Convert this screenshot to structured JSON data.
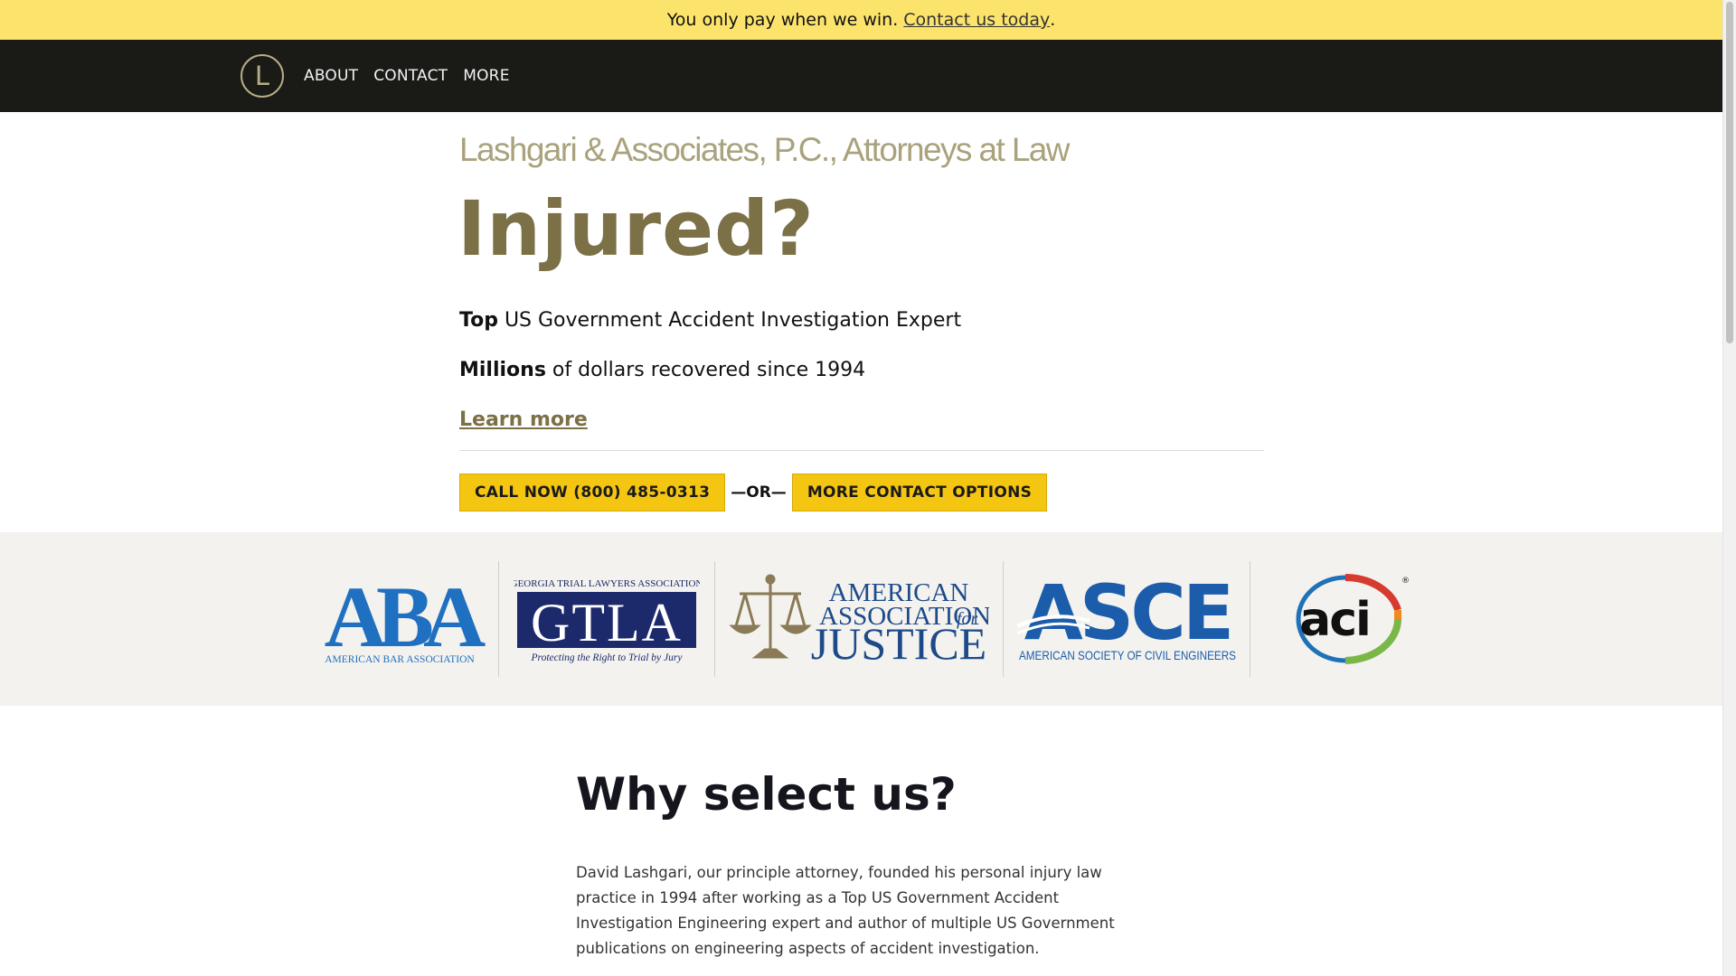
{
  "banner": {
    "text": "You only pay when we win.",
    "link": "Contact us today",
    "period": "."
  },
  "nav": {
    "logo_letter": "L",
    "items": [
      "ABOUT",
      "CONTACT",
      "MORE"
    ]
  },
  "hero": {
    "firm_name": "Lashgari & Associates, P.C., Attorneys at Law",
    "headline": "Injured?",
    "claims": [
      {
        "strong": "Top",
        "rest": " US Government Accident Investigation Expert"
      },
      {
        "strong": "Millions",
        "rest": " of dollars recovered since 1994"
      }
    ],
    "learn_more": "Learn more",
    "call_button": "CALL NOW (800) 485-0313",
    "or_text": "—OR—",
    "contact_button": "MORE CONTACT OPTIONS"
  },
  "associations": {
    "aba": {
      "mark": "ABA",
      "caption": "AMERICAN BAR ASSOCIATION"
    },
    "gtla": {
      "top": "GEORGIA TRIAL LAWYERS ASSOCIATION",
      "mark": "GTLA",
      "tagline": "Protecting the Right to Trial by Jury"
    },
    "aaj": {
      "line1": "AMERICAN",
      "line2": "ASSOCIATION",
      "line2b": "for",
      "line3": "JUSTICE"
    },
    "asce": {
      "mark": "ASCE",
      "caption": "AMERICAN SOCIETY OF CIVIL ENGINEERS"
    },
    "aci": {
      "mark": "aci",
      "registered": "®"
    }
  },
  "why": {
    "title": "Why select us?",
    "body": "David Lashgari, our principle attorney, founded his personal injury law practice in 1994 after working as a Top US Government Accident Investigation Engineering expert and author of multiple US Government publications on engineering aspects of accident investigation."
  },
  "colors": {
    "banner": "#fce46c",
    "navbar": "#1a1a16",
    "accent_gold": "#7c7046",
    "button": "#f5c611",
    "aba_blue": "#1f70c1",
    "asce_blue": "#1b5dab",
    "gtla_navy": "#1c2a6b"
  }
}
